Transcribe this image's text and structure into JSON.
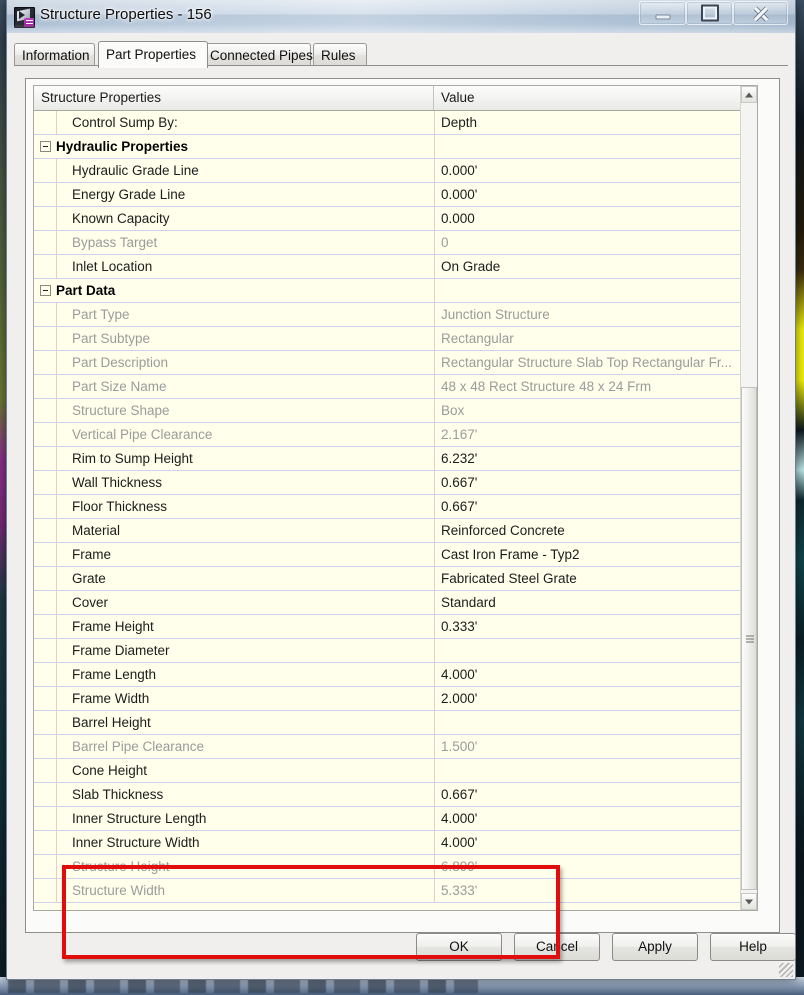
{
  "window": {
    "title": "Structure Properties - 156",
    "icon": "civil3d-app-icon",
    "controls": {
      "minimize": "minimize-icon",
      "maximize": "maximize-icon",
      "close": "close-icon"
    }
  },
  "tabs": [
    {
      "label": "Information",
      "active": false
    },
    {
      "label": "Part Properties",
      "active": true
    },
    {
      "label": "Connected Pipes",
      "active": false
    },
    {
      "label": "Rules",
      "active": false
    }
  ],
  "grid": {
    "headers": [
      "Structure Properties",
      "Value"
    ],
    "rows": [
      {
        "name": "Control Sump By:",
        "value": "Depth",
        "type": "row",
        "dim": false
      },
      {
        "name": "Hydraulic Properties",
        "value": "",
        "type": "group",
        "dim": false
      },
      {
        "name": "Hydraulic Grade Line",
        "value": "0.000'",
        "type": "row",
        "dim": false
      },
      {
        "name": "Energy Grade Line",
        "value": "0.000'",
        "type": "row",
        "dim": false
      },
      {
        "name": "Known Capacity",
        "value": "0.000",
        "type": "row",
        "dim": false
      },
      {
        "name": "Bypass Target",
        "value": "0",
        "type": "row",
        "dim": true
      },
      {
        "name": "Inlet Location",
        "value": "On Grade",
        "type": "row",
        "dim": false
      },
      {
        "name": "Part Data",
        "value": "",
        "type": "group",
        "dim": false
      },
      {
        "name": "Part Type",
        "value": "Junction Structure",
        "type": "row",
        "dim": true
      },
      {
        "name": "Part Subtype",
        "value": "Rectangular",
        "type": "row",
        "dim": true
      },
      {
        "name": "Part Description",
        "value": "Rectangular Structure Slab Top Rectangular Fr...",
        "type": "row",
        "dim": true
      },
      {
        "name": "Part Size Name",
        "value": "48 x 48 Rect Structure 48 x 24 Frm",
        "type": "row",
        "dim": true
      },
      {
        "name": "Structure Shape",
        "value": "Box",
        "type": "row",
        "dim": true
      },
      {
        "name": "Vertical Pipe Clearance",
        "value": "2.167'",
        "type": "row",
        "dim": true
      },
      {
        "name": "Rim to Sump Height",
        "value": "6.232'",
        "type": "row",
        "dim": false
      },
      {
        "name": "Wall Thickness",
        "value": "0.667'",
        "type": "row",
        "dim": false
      },
      {
        "name": "Floor Thickness",
        "value": "0.667'",
        "type": "row",
        "dim": false
      },
      {
        "name": "Material",
        "value": "Reinforced Concrete",
        "type": "row",
        "dim": false
      },
      {
        "name": "Frame",
        "value": "Cast Iron Frame - Typ2",
        "type": "row",
        "dim": false
      },
      {
        "name": "Grate",
        "value": "Fabricated Steel Grate",
        "type": "row",
        "dim": false
      },
      {
        "name": "Cover",
        "value": "Standard",
        "type": "row",
        "dim": false
      },
      {
        "name": "Frame Height",
        "value": "0.333'",
        "type": "row",
        "dim": false
      },
      {
        "name": "Frame Diameter",
        "value": "",
        "type": "row",
        "dim": false
      },
      {
        "name": "Frame Length",
        "value": "4.000'",
        "type": "row",
        "dim": false
      },
      {
        "name": "Frame Width",
        "value": "2.000'",
        "type": "row",
        "dim": false
      },
      {
        "name": "Barrel Height",
        "value": "",
        "type": "row",
        "dim": false
      },
      {
        "name": "Barrel Pipe Clearance",
        "value": "1.500'",
        "type": "row",
        "dim": true
      },
      {
        "name": "Cone Height",
        "value": "",
        "type": "row",
        "dim": false
      },
      {
        "name": "Slab Thickness",
        "value": "0.667'",
        "type": "row",
        "dim": false
      },
      {
        "name": "Inner Structure Length",
        "value": "4.000'",
        "type": "row",
        "dim": false
      },
      {
        "name": "Inner Structure Width",
        "value": "4.000'",
        "type": "row",
        "dim": false
      },
      {
        "name": "Structure Height",
        "value": "6.899'",
        "type": "row",
        "dim": true
      },
      {
        "name": "Structure Width",
        "value": "5.333'",
        "type": "row",
        "dim": true
      }
    ]
  },
  "scrollbar": {
    "up_arrow": "scroll-up-icon",
    "down_arrow": "scroll-down-icon",
    "thumb": "scroll-thumb"
  },
  "annotation": {
    "color": "#e10d0d",
    "note": "red highlight box around Slab Thickness / Inner Structure Length / Inner Structure Width / Structure Height"
  },
  "buttons": [
    {
      "label": "OK",
      "id": "b-ok"
    },
    {
      "label": "Cancel",
      "id": "b-cancel"
    },
    {
      "label": "Apply",
      "id": "b-apply"
    },
    {
      "label": "Help",
      "id": "b-help"
    }
  ],
  "colors": {
    "grid_background": "#ffffec",
    "grid_rule": "#cfd0ee",
    "grid_indent_rule": "#f0c8c4",
    "disabled_text": "#9b9b9b",
    "annotation_red": "#e10d0d"
  }
}
